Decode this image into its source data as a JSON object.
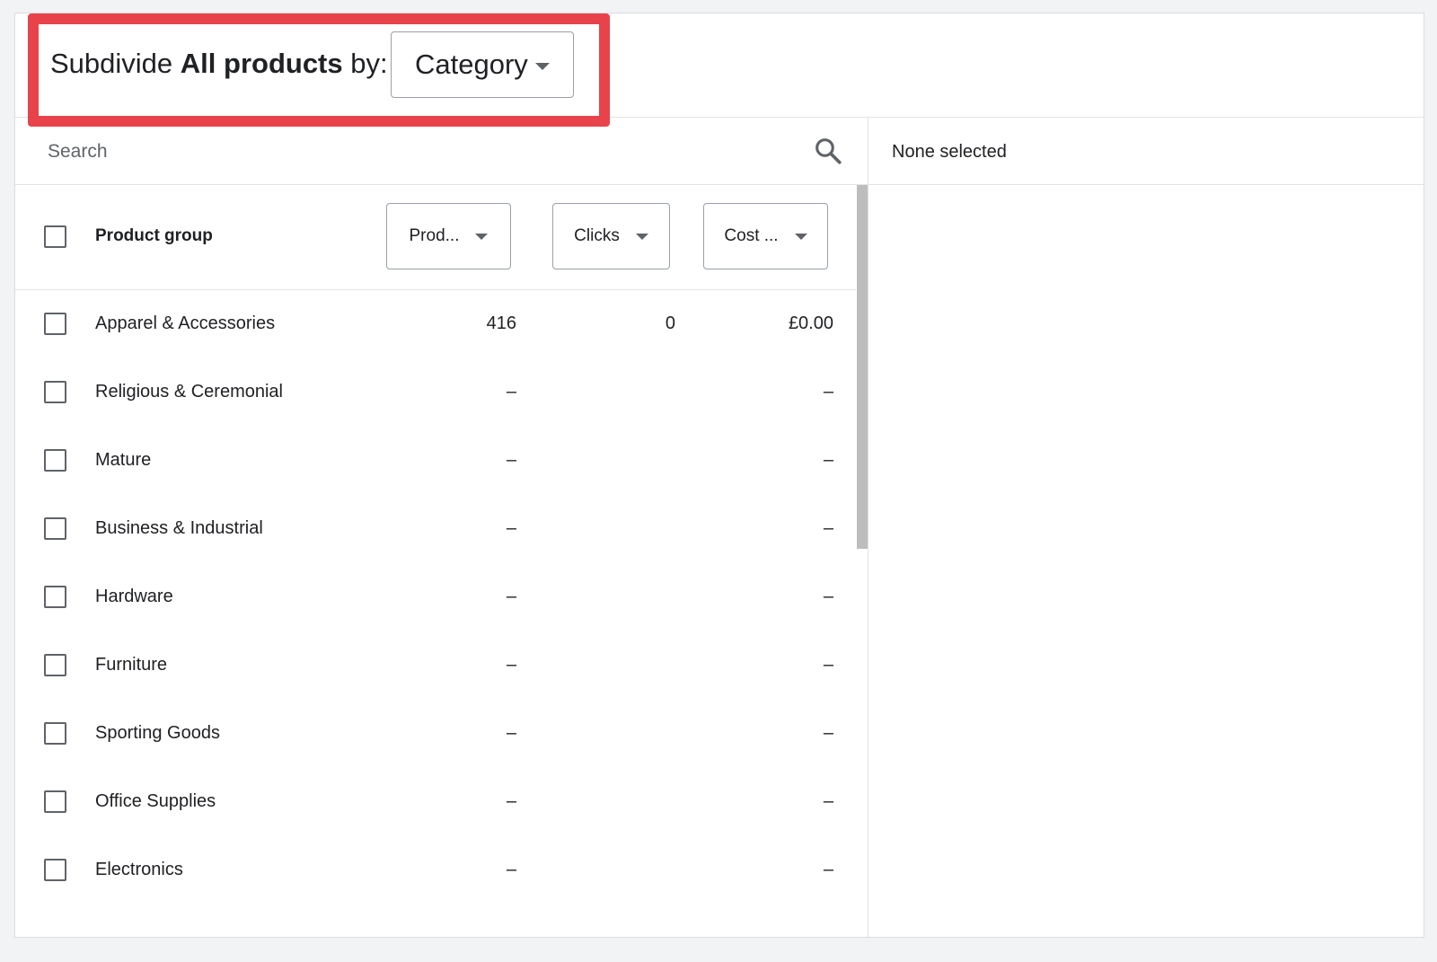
{
  "header": {
    "prefix": "Subdivide",
    "bold_text": "All products",
    "suffix": "by:",
    "dropdown_value": "Category"
  },
  "search": {
    "placeholder": "Search"
  },
  "table": {
    "column_label": "Product group",
    "columns": [
      {
        "label": "Prod..."
      },
      {
        "label": "Clicks"
      },
      {
        "label": "Cost ..."
      }
    ],
    "rows": [
      {
        "name": "Apparel & Accessories",
        "products": "416",
        "clicks": "0",
        "cost": "£0.00"
      },
      {
        "name": "Religious & Ceremonial",
        "products": "–",
        "clicks": "",
        "cost": "–"
      },
      {
        "name": "Mature",
        "products": "–",
        "clicks": "",
        "cost": "–"
      },
      {
        "name": "Business & Industrial",
        "products": "–",
        "clicks": "",
        "cost": "–"
      },
      {
        "name": "Hardware",
        "products": "–",
        "clicks": "",
        "cost": "–"
      },
      {
        "name": "Furniture",
        "products": "–",
        "clicks": "",
        "cost": "–"
      },
      {
        "name": "Sporting Goods",
        "products": "–",
        "clicks": "",
        "cost": "–"
      },
      {
        "name": "Office Supplies",
        "products": "–",
        "clicks": "",
        "cost": "–"
      },
      {
        "name": "Electronics",
        "products": "–",
        "clicks": "",
        "cost": "–"
      }
    ]
  },
  "selection": {
    "status": "None selected"
  },
  "colors": {
    "highlight": "#e8434a",
    "border": "#dadce0",
    "text": "#202124",
    "scroll_thumb": "#bdbdbd"
  }
}
